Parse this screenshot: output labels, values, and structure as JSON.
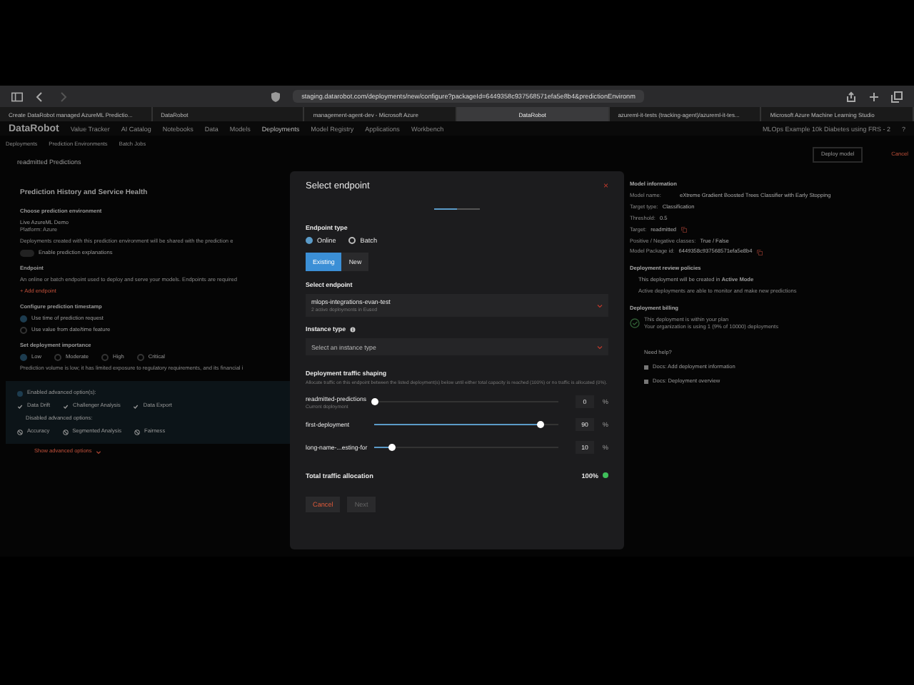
{
  "browser": {
    "address": "staging.datarobot.com/deployments/new/configure?packageId=6449358c937568571efa5e8b4&predictionEnvironm",
    "tabs": [
      {
        "label": "Create DataRobot managed AzureML Predictio...",
        "selected": false
      },
      {
        "label": "DataRobot",
        "selected": false
      },
      {
        "label": "management-agent-dev - Microsoft Azure",
        "selected": false
      },
      {
        "label": "DataRobot",
        "selected": true
      },
      {
        "label": "azureml-it-tests (tracking-agent)/azureml-it-tes...",
        "selected": false
      },
      {
        "label": "Microsoft Azure Machine Learning Studio",
        "selected": false
      }
    ]
  },
  "app_nav": {
    "logo": "DataRobot",
    "items": [
      {
        "label": "Value Tracker",
        "selected": false
      },
      {
        "label": "AI Catalog",
        "selected": false
      },
      {
        "label": "Notebooks",
        "selected": false
      },
      {
        "label": "Data",
        "selected": false
      },
      {
        "label": "Models",
        "selected": false
      },
      {
        "label": "Deployments",
        "selected": true
      },
      {
        "label": "Model Registry",
        "selected": false
      },
      {
        "label": "Applications",
        "selected": false
      },
      {
        "label": "Workbench",
        "selected": false
      }
    ],
    "project": "MLOps Example 10k Diabetes using FRS - 2",
    "help": "?"
  },
  "page": {
    "breadcrumb": [
      "Deployments",
      "Prediction Environments",
      "Batch Jobs"
    ],
    "title": "readmitted Predictions",
    "section_title": "Prediction History and Service Health",
    "environment_label": "Choose prediction environment",
    "environment_name": "Live AzureML Demo",
    "environment_platform": "Platform: Azure",
    "environment_note": "Deployments created with this prediction environment will be shared with the prediction e",
    "explanations": {
      "label": "Enable prediction explanations",
      "on": false
    },
    "endpoint_label": "Endpoint",
    "endpoint_note": "An online or batch endpoint used to deploy and serve your models. Endpoints are required",
    "add_endpoint": "+ Add endpoint",
    "timestamp_label": "Configure prediction timestamp",
    "timestamp_options": [
      {
        "label": "Use time of prediction request",
        "selected": true
      },
      {
        "label": "Use value from date/time feature",
        "selected": false
      }
    ],
    "importance_label": "Set deployment importance",
    "importance_options": [
      {
        "label": "Low",
        "selected": true
      },
      {
        "label": "Moderate",
        "selected": false
      },
      {
        "label": "High",
        "selected": false
      },
      {
        "label": "Critical",
        "selected": false
      }
    ],
    "importance_note": "Prediction volume is low; it has limited exposure to regulatory requirements, and its financial i",
    "enabled_title": "Enabled advanced option(s):",
    "enabled": [
      "Data Drift",
      "Challenger Analysis",
      "Data Export"
    ],
    "disabled_title": "Disabled advanced options:",
    "disabled": [
      "Accuracy",
      "Segmented Analysis",
      "Fairness"
    ],
    "show_advanced": "Show advanced options"
  },
  "side": {
    "deploy": "Deploy model",
    "cancel": "Cancel",
    "info_title": "Model information",
    "info": [
      {
        "label": "Model name:",
        "value": "eXtreme Gradient Boosted Trees Classifier with Early Stopping",
        "kind": "link"
      },
      {
        "label": "Target type:",
        "value": "Classification",
        "kind": "text"
      },
      {
        "label": "Threshold:",
        "value": "0.5",
        "kind": "text"
      },
      {
        "label": "Target:",
        "value": "readmitted",
        "kind": "copy"
      },
      {
        "label": "Positive / Negative classes:",
        "value": "True / False",
        "kind": "text"
      },
      {
        "label": "Model Package id:",
        "value": "6449358c937568571efa5e8b4",
        "kind": "copy"
      }
    ],
    "review_title": "Deployment review policies",
    "review_text": "This deployment will be created in",
    "review_mode": "Active Mode",
    "review_note": "Active deployments are able to monitor and make new predictions",
    "billing_title": "Deployment billing",
    "billing_text": "This deployment is within your plan",
    "billing_note": "Your organization is using 1 (9% of 10000) deployments",
    "help_title": "Need help?",
    "help_links": [
      "Docs: Add deployment information",
      "Docs: Deployment overview"
    ]
  },
  "modal": {
    "title": "Select endpoint",
    "close": "×",
    "steps": [
      {
        "active": true
      },
      {
        "active": false
      }
    ],
    "type_label": "Endpoint type",
    "types": [
      {
        "label": "Online",
        "selected": true
      },
      {
        "label": "Batch",
        "selected": false
      }
    ],
    "modes": [
      {
        "label": "Existing",
        "selected": true
      },
      {
        "label": "New",
        "selected": false
      }
    ],
    "endpoint_label": "Select endpoint",
    "endpoint_value": "mlops-integrations-evan-test",
    "endpoint_sub": "2 active deployments in Eused",
    "instance_label": "Instance type",
    "instance_placeholder": "Select an instance type",
    "traffic_title": "Deployment traffic shaping",
    "traffic_note": "Allocate traffic on this endpoint between the listed deployment(s) below until either total capacity is reached (100%) or no traffic is allocated (0%).",
    "deployments": [
      {
        "name": "readmitted-predictions",
        "sub": "Current deployment",
        "level": 0,
        "value": "0",
        "unit": "%"
      },
      {
        "name": "first-deployment",
        "level": 0.9,
        "value": "90",
        "unit": "%"
      },
      {
        "name": "long-name-...esting-for",
        "level": 0.1,
        "value": "10",
        "unit": "%"
      }
    ],
    "total_label": "Total traffic allocation",
    "total_value": "100%",
    "total_ok": true,
    "cancel": "Cancel",
    "next": "Next",
    "next_disabled": true
  }
}
